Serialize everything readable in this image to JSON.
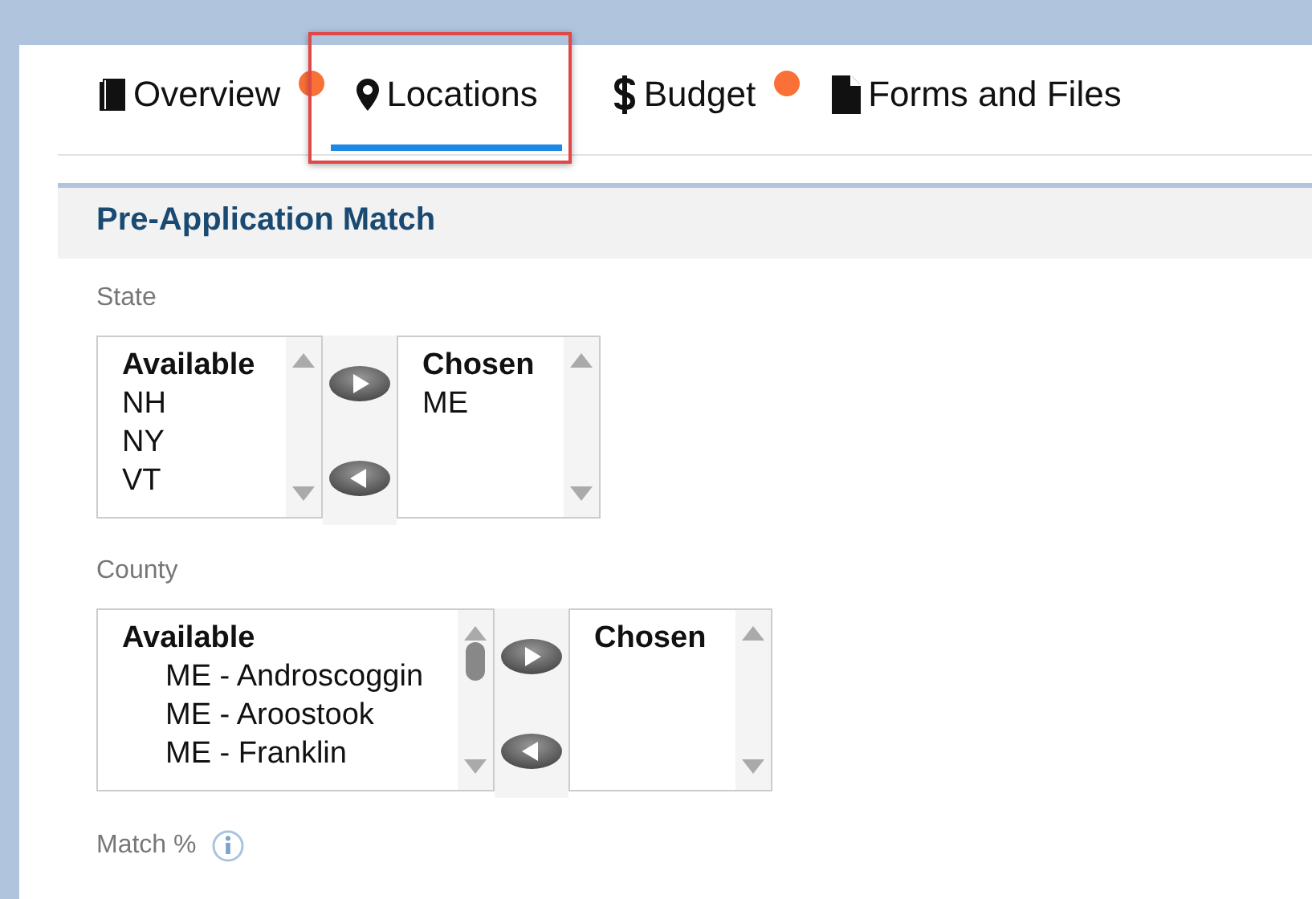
{
  "tabs": [
    {
      "label": "Overview",
      "selected": false,
      "badge": true,
      "highlighted": false
    },
    {
      "label": "Locations",
      "selected": true,
      "badge": false,
      "highlighted": true
    },
    {
      "label": "Budget",
      "selected": false,
      "badge": true,
      "highlighted": false
    },
    {
      "label": "Forms and Files",
      "selected": false,
      "badge": false,
      "highlighted": false
    }
  ],
  "section": {
    "title": "Pre-Application Match",
    "pickers": [
      {
        "label": "State",
        "grouped": false,
        "available": {
          "heading": "Available",
          "options": [
            "NH",
            "NY",
            "VT"
          ],
          "scroll_thumb": false
        },
        "chosen": {
          "heading": "Chosen",
          "options": [
            "ME"
          ],
          "scroll_thumb": false
        }
      },
      {
        "label": "County",
        "grouped": true,
        "available": {
          "heading": "Available",
          "options": [
            "ME - Androscoggin",
            "ME - Aroostook",
            "ME - Franklin"
          ],
          "scroll_thumb": true
        },
        "chosen": {
          "heading": "Chosen",
          "scroll_thumb": false
        }
      }
    ],
    "match_label": "Match %"
  }
}
